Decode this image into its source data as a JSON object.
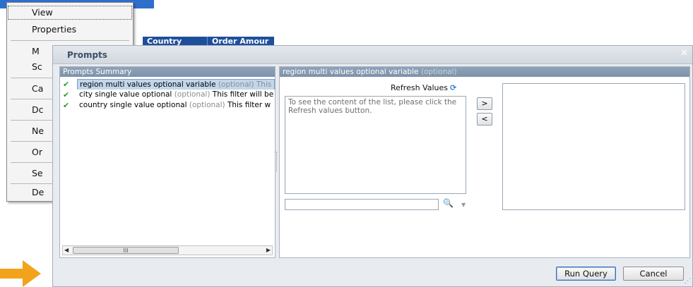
{
  "context_menu": {
    "items": [
      {
        "label": "View"
      },
      {
        "label": "Properties"
      },
      {
        "label": "M"
      },
      {
        "label": "Sc"
      },
      {
        "label": "Ca"
      },
      {
        "label": "Dc"
      },
      {
        "label": "Ne"
      },
      {
        "label": "Or"
      },
      {
        "label": "Se"
      },
      {
        "label": "De"
      }
    ]
  },
  "grid_header": {
    "columns": [
      "Country",
      "Order Amour"
    ]
  },
  "dialog": {
    "title": "Prompts",
    "close_glyph": "✕",
    "summary": {
      "header": "Prompts Summary",
      "rows": [
        {
          "name": "region multi values optional variable",
          "opt": "(optional) This",
          "rest": ""
        },
        {
          "name": "city single value optional",
          "opt": "(optional)",
          "rest": "This filter will be"
        },
        {
          "name": "country single value optional",
          "opt": "(optional)",
          "rest": "This filter w"
        }
      ],
      "scroll_thumb": "III"
    },
    "detail": {
      "header_name": "region multi values optional variable",
      "header_opt": "(optional)",
      "refresh_label": "Refresh Values",
      "list_message": "To see the content of the list, please click the Refresh values button.",
      "search_value": "",
      "add_label": ">",
      "remove_label": "<"
    },
    "buttons": {
      "run_query": "Run Query",
      "cancel": "Cancel"
    }
  },
  "colors": {
    "accent_blue": "#2f6fcc",
    "panel_head": "#8fa3b9",
    "check_green": "#2e9a2e",
    "arrow_orange": "#f3a31b"
  },
  "icons": [
    "check-icon",
    "refresh-icon",
    "search-icon",
    "dropdown-icon",
    "close-icon",
    "resize-grip-icon",
    "arrow-pointer-icon"
  ]
}
